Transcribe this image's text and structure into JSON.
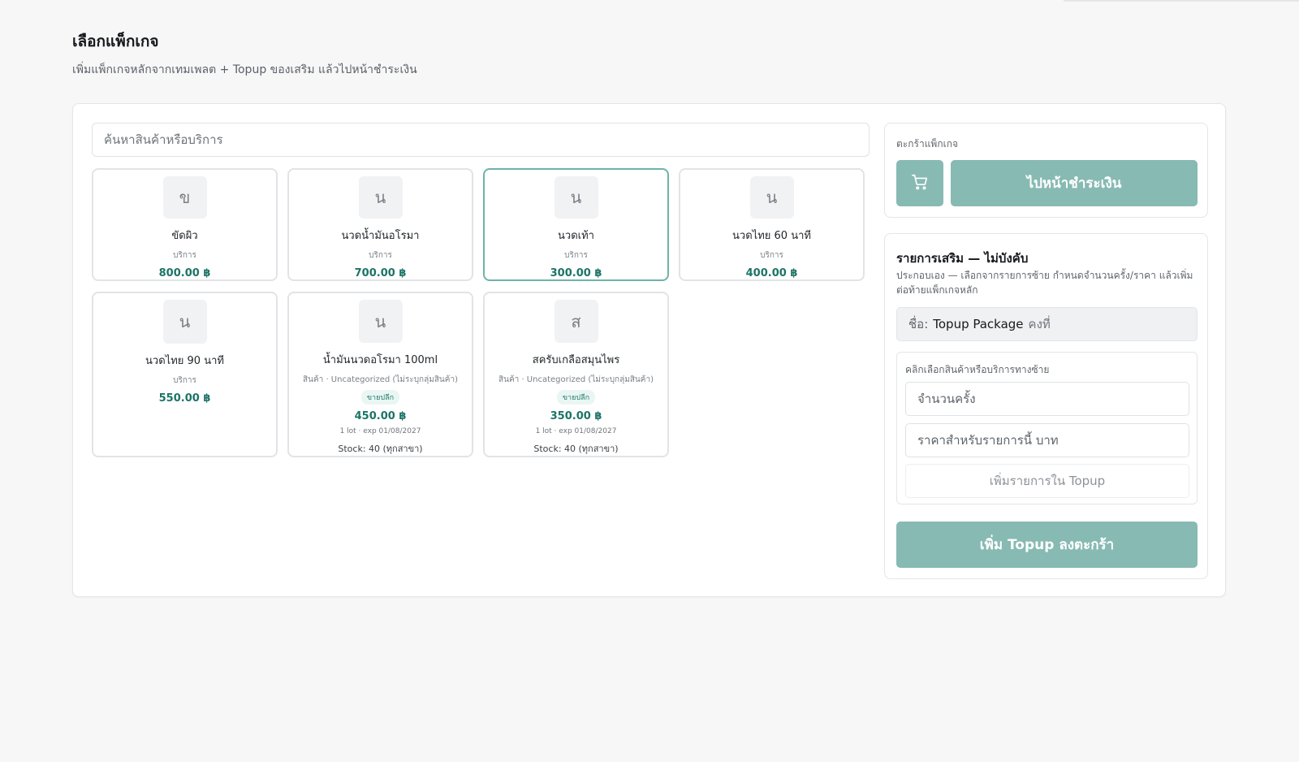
{
  "header": {
    "title": "เลือกแพ็กเกจ",
    "subtitle": "เพิ่มแพ็กเกจหลักจากเทมเพลต + Topup ของเสริม แล้วไปหน้าชำระเงิน"
  },
  "search": {
    "placeholder": "ค้นหาสินค้าหรือบริการ"
  },
  "products": [
    {
      "initial": "ข",
      "name": "ขัดผิว",
      "type": "บริการ",
      "price": "800.00 ฿"
    },
    {
      "initial": "น",
      "name": "นวดน้ำมันอโรมา",
      "type": "บริการ",
      "price": "700.00 ฿"
    },
    {
      "initial": "น",
      "name": "นวดเท้า",
      "type": "บริการ",
      "price": "300.00 ฿",
      "selected": true
    },
    {
      "initial": "น",
      "name": "นวดไทย 60 นาที",
      "type": "บริการ",
      "price": "400.00 ฿"
    },
    {
      "initial": "น",
      "name": "นวดไทย 90 นาที",
      "type": "บริการ",
      "price": "550.00 ฿"
    },
    {
      "initial": "น",
      "name": "น้ำมันนวดอโรมา 100ml",
      "type": "สินค้า · Uncategorized (ไม่ระบุกลุ่มสินค้า)",
      "badge": "ขายปลีก",
      "price": "450.00 ฿",
      "lot": "1 lot · exp 01/08/2027",
      "stock": "Stock: 40 (ทุกสาขา)"
    },
    {
      "initial": "ส",
      "name": "สครับเกลือสมุนไพร",
      "type": "สินค้า · Uncategorized (ไม่ระบุกลุ่มสินค้า)",
      "badge": "ขายปลีก",
      "price": "350.00 ฿",
      "lot": "1 lot · exp 01/08/2027",
      "stock": "Stock: 40 (ทุกสาขา)"
    }
  ],
  "cart": {
    "label": "ตะกร้าแพ็กเกจ",
    "icon": "shopping-cart-icon",
    "checkout_label": "ไปหน้าชำระเงิน"
  },
  "topup": {
    "title": "รายการเสริม — ไม่บังคับ",
    "description": "ประกอบเอง — เลือกจากรายการซ้าย กำหนดจำนวนครั้ง/ราคา แล้วเพิ่มต่อท้ายแพ็กเกจหลัก",
    "name_prefix": "ชื่อ:",
    "name_value": "Topup Package",
    "name_suffix": "คงที่",
    "item_hint": "คลิกเลือกสินค้าหรือบริการทางซ้าย",
    "qty_placeholder": "จำนวนครั้ง",
    "price_placeholder": "ราคาสำหรับรายการนี้ บาท",
    "add_item_label": "เพิ่มรายการใน Topup",
    "add_topup_label": "เพิ่ม Topup ลงตะกร้า"
  },
  "colors": {
    "accent": "#87bab3",
    "price": "#1c7467",
    "selected_border": "#6fb3a9"
  }
}
